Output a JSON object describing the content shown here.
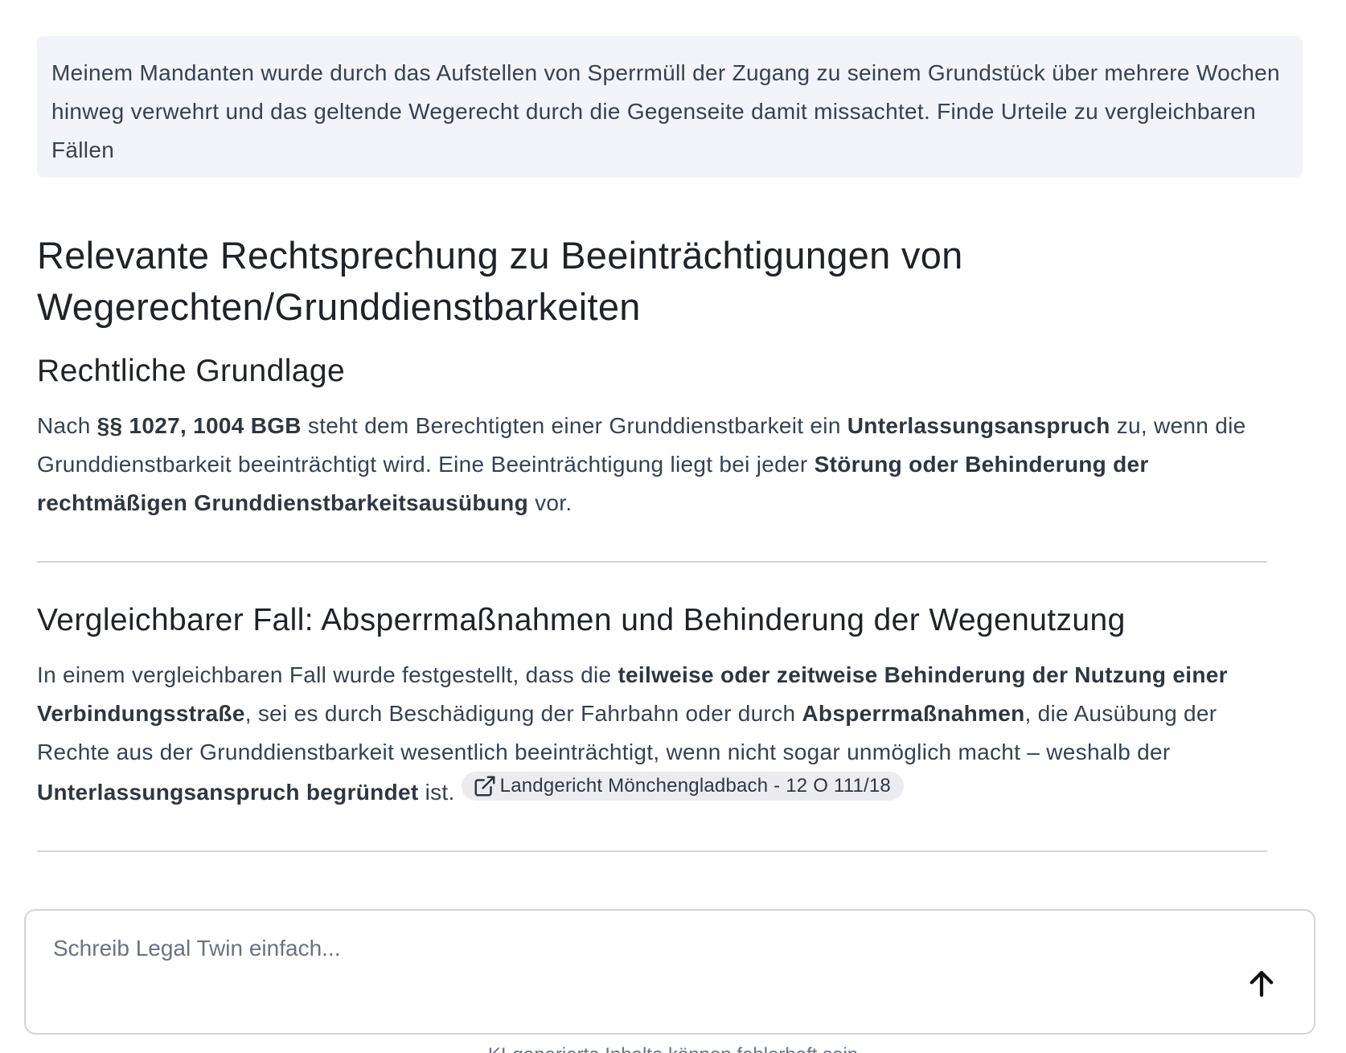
{
  "user_message": {
    "text": "Meinem Mandanten wurde durch das Aufstellen von Sperrmüll der Zugang zu seinem Grundstück über mehrere Wochen hinweg verwehrt und das geltende Wegerecht durch die Gegenseite damit missachtet. Finde Urteile zu vergleichbaren Fällen"
  },
  "answer": {
    "title": "Relevante Rechtsprechung zu Beeinträchtigungen von Wegerechten/Grunddienstbarkeiten",
    "section1": {
      "heading": "Rechtliche Grundlage",
      "p1_t1": "Nach ",
      "p1_b1": "§§ 1027, 1004 BGB",
      "p1_t2": " steht dem Berechtigten einer Grunddienstbarkeit ein ",
      "p1_b2": "Unterlassungsanspruch",
      "p1_t3": " zu, wenn die Grunddienstbarkeit beeinträchtigt wird. Eine Beeinträchtigung liegt bei jeder ",
      "p1_b3": "Störung oder Behinderung der rechtmäßigen Grunddienstbarkeitsausübung",
      "p1_t4": " vor."
    },
    "section2": {
      "heading": "Vergleichbarer Fall: Absperrmaßnahmen und Behinderung der Wegenutzung",
      "p_t1": "In einem vergleichbaren Fall wurde festgestellt, dass die ",
      "p_b1": "teilweise oder zeitweise Behinderung der Nutzung einer Verbindungsstraße",
      "p_t2": ", sei es durch Beschädigung der Fahrbahn oder durch ",
      "p_b2": "Absperrmaßnahmen",
      "p_t3": ", die Ausübung der Rechte aus der Grunddienstbarkeit wesentlich beeinträchtigt, wenn nicht sogar unmöglich macht – weshalb der ",
      "p_b3": "Unterlassungsanspruch begründet",
      "p_t4": " ist.",
      "citation": "Landgericht Mönchengladbach - 12 O 111/18",
      "citation_icon": "external-link-icon"
    }
  },
  "composer": {
    "placeholder": "Schreib Legal Twin einfach...",
    "value": "",
    "send_icon": "arrow-up-icon"
  },
  "disclaimer": "KI-generierte Inhalte können fehlerhaft sein"
}
